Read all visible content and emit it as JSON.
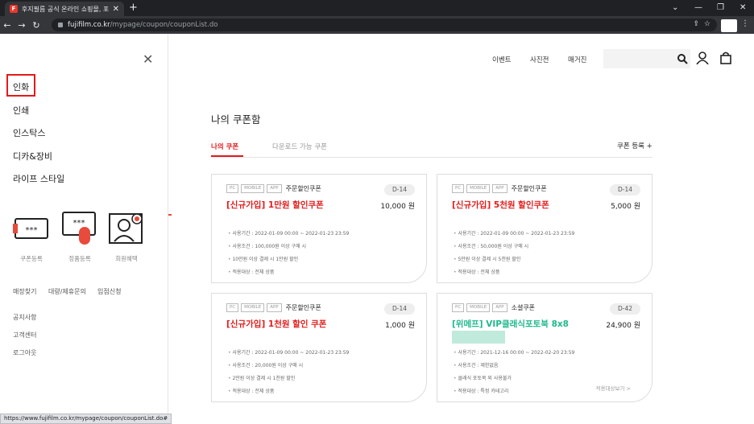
{
  "browser": {
    "tab_title": "후지필름 공식 온라인 쇼핑몰, 포",
    "favicon": "F",
    "url_host": "fujifilm.co.kr",
    "url_path": "/mypage/coupon/couponList.do",
    "status_url": "https://www.fujifilm.co.kr/mypage/coupon/couponList.do#"
  },
  "sidebar": {
    "menu": [
      "인화",
      "인쇄",
      "인스탁스",
      "디카&장비",
      "라이프 스타일"
    ],
    "icons": [
      {
        "label": "쿠폰등록",
        "icon": "coupon-icon"
      },
      {
        "label": "정품등록",
        "icon": "product-register-icon"
      },
      {
        "label": "회원혜택",
        "icon": "member-benefit-icon"
      }
    ],
    "links": [
      "매장찾기",
      "대량/제휴문의",
      "입점신청"
    ],
    "footer_links": [
      "공지사항",
      "고객센터",
      "로그아웃"
    ]
  },
  "header": {
    "nav": [
      "이벤트",
      "사진전",
      "매거진"
    ]
  },
  "main": {
    "title": "나의 쿠폰함",
    "tab_mine": "나의 쿠폰",
    "tab_download": "다운로드 가능 쿠폰",
    "register_label": "쿠폰 등록 +",
    "coupons": [
      {
        "tags": [
          "PC",
          "MOBILE",
          "APP"
        ],
        "type": "주문할인쿠폰",
        "dday": "D-14",
        "name": "[신규가입] 1만원 할인쿠폰",
        "value": "10,000 원",
        "details": [
          "사용기간 : 2022-01-09 00:00 ~ 2022-01-23 23:59",
          "사용조건 : 100,000원 이상 구매 시",
          "10만원 이상 결제 시 1만원 할인",
          "적용대상 : 전체 상품"
        ]
      },
      {
        "tags": [
          "PC",
          "MOBILE",
          "APP"
        ],
        "type": "주문할인쿠폰",
        "dday": "D-14",
        "name": "[신규가입] 5천원 할인쿠폰",
        "value": "5,000 원",
        "details": [
          "사용기간 : 2022-01-09 00:00 ~ 2022-01-23 23:59",
          "사용조건 : 50,000원 이상 구매 시",
          "5만원 이상 결제 시 5천원 할인",
          "적용대상 : 전체 상품"
        ]
      },
      {
        "tags": [
          "PC",
          "MOBILE",
          "APP"
        ],
        "type": "주문할인쿠폰",
        "dday": "D-14",
        "name": "[신규가입] 1천원 할인 쿠폰",
        "value": "1,000 원",
        "details": [
          "사용기간 : 2022-01-09 00:00 ~ 2022-01-23 23:59",
          "사용조건 : 20,000원 이상 구매 시",
          "2만원 이상 결제 시 1천원 할인",
          "적용대상 : 전체 상품"
        ]
      },
      {
        "tags": [
          "PC",
          "MOBILE",
          "APP"
        ],
        "type": "소셜쿠폰",
        "dday": "D-42",
        "name": "[위메프] VIP클래식포토북 8x8",
        "value": "24,900 원",
        "details": [
          "사용기간 : 2021-12-16 00:00 ~ 2022-02-20 23:59",
          "사용조건 : 제한없음",
          "클래식 포토북 외 사용불가",
          "적용대상 : 특정 카테고리"
        ],
        "target_link": "적용대상보기 >"
      }
    ]
  },
  "colors": {
    "accent_red": "#e31b1b",
    "social_green": "#1fb98d"
  }
}
